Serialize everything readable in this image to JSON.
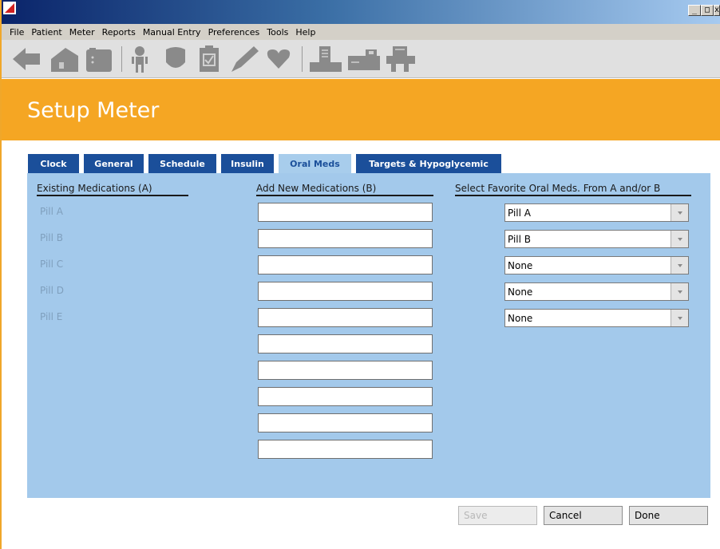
{
  "window": {
    "controls": [
      "_",
      "□",
      "x"
    ]
  },
  "menu": [
    "File",
    "Patient",
    "Meter",
    "Reports",
    "Manual Entry",
    "Preferences",
    "Tools",
    "Help"
  ],
  "toolbar_icons": [
    "back-arrow-icon",
    "home-icon",
    "meter-icon",
    "person-icon",
    "shield-icon",
    "clipboard-icon",
    "pen-icon",
    "heart-icon",
    "report-icon",
    "card-reader-icon",
    "printer-icon"
  ],
  "page": {
    "title": "Setup Meter"
  },
  "tabs": [
    {
      "label": "Clock",
      "active": false
    },
    {
      "label": "General",
      "active": false
    },
    {
      "label": "Schedule",
      "active": false
    },
    {
      "label": "Insulin",
      "active": false
    },
    {
      "label": "Oral Meds",
      "active": true
    },
    {
      "label": "Targets & Hypoglycemic",
      "active": false
    }
  ],
  "columns": {
    "existing": "Existing Medications (A)",
    "add_new": "Add New Medications (B)",
    "favorite": "Select Favorite Oral Meds. From A and/or B"
  },
  "existing_meds": [
    "Pill A",
    "Pill B",
    "Pill C",
    "Pill D",
    "Pill E"
  ],
  "new_meds": [
    "",
    "",
    "",
    "",
    "",
    "",
    "",
    "",
    "",
    ""
  ],
  "favorites": [
    "Pill A",
    "Pill B",
    "None",
    "None",
    "None"
  ],
  "buttons": {
    "save": "Save",
    "cancel": "Cancel",
    "done": "Done"
  },
  "colors": {
    "accent": "#f5a623",
    "tab": "#1b4f9a",
    "panel": "#a3c9eb"
  }
}
